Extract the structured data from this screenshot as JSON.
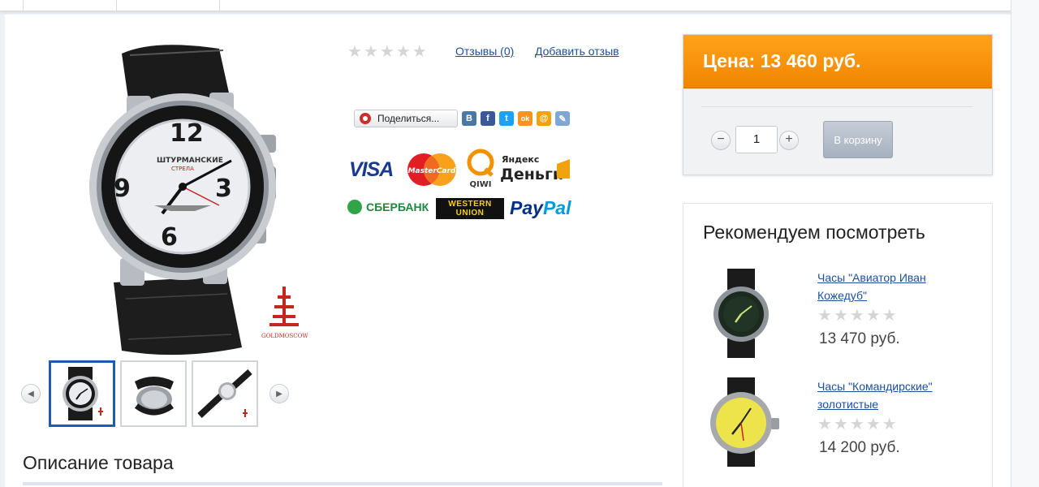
{
  "product": {
    "rating_stars": 5,
    "reviews_link": "Отзывы (0)",
    "add_review_link": "Добавить отзыв",
    "share_label": "Поделиться...",
    "photo_brand_text": "GOLDMOSCOW",
    "dial_brand": "ШТУРМАНСКИЕ",
    "dial_brand_sub": "СТРЕЛА"
  },
  "social": [
    "В",
    "f",
    "t",
    "ok",
    "@",
    "✎"
  ],
  "payments": {
    "visa": "VISA",
    "mastercard": "MasterCard",
    "qiwi": "QIWI",
    "yandex_top": "Яндекс",
    "yandex_bottom": "Деньги",
    "sberbank": "СБЕРБАНК",
    "western_union_top": "WESTERN",
    "western_union_bottom": "UNION",
    "paypal_pay": "Pay",
    "paypal_pal": "Pal"
  },
  "price_box": {
    "price_label": "Цена: 13 460 руб.",
    "quantity": "1",
    "cart_button": "В корзину",
    "minus": "−",
    "plus": "+"
  },
  "recommended": {
    "title": "Рекомендуем посмотреть",
    "items": [
      {
        "name": "Часы \"Авиатор Иван Кожедуб\"",
        "price": "13 470 руб.",
        "rating": 0
      },
      {
        "name": "Часы \"Командирские\" золотистые",
        "price": "14 200 руб.",
        "rating": 0
      }
    ]
  },
  "description": {
    "title": "Описание товара"
  },
  "colors": {
    "accent_orange": "#f59000",
    "link_blue": "#1c4fa0",
    "thumb_active": "#1e5ab3"
  },
  "icons": [
    "arrow-left-icon",
    "arrow-right-icon",
    "share-icon",
    "star-icon",
    "minus-icon",
    "plus-icon"
  ]
}
